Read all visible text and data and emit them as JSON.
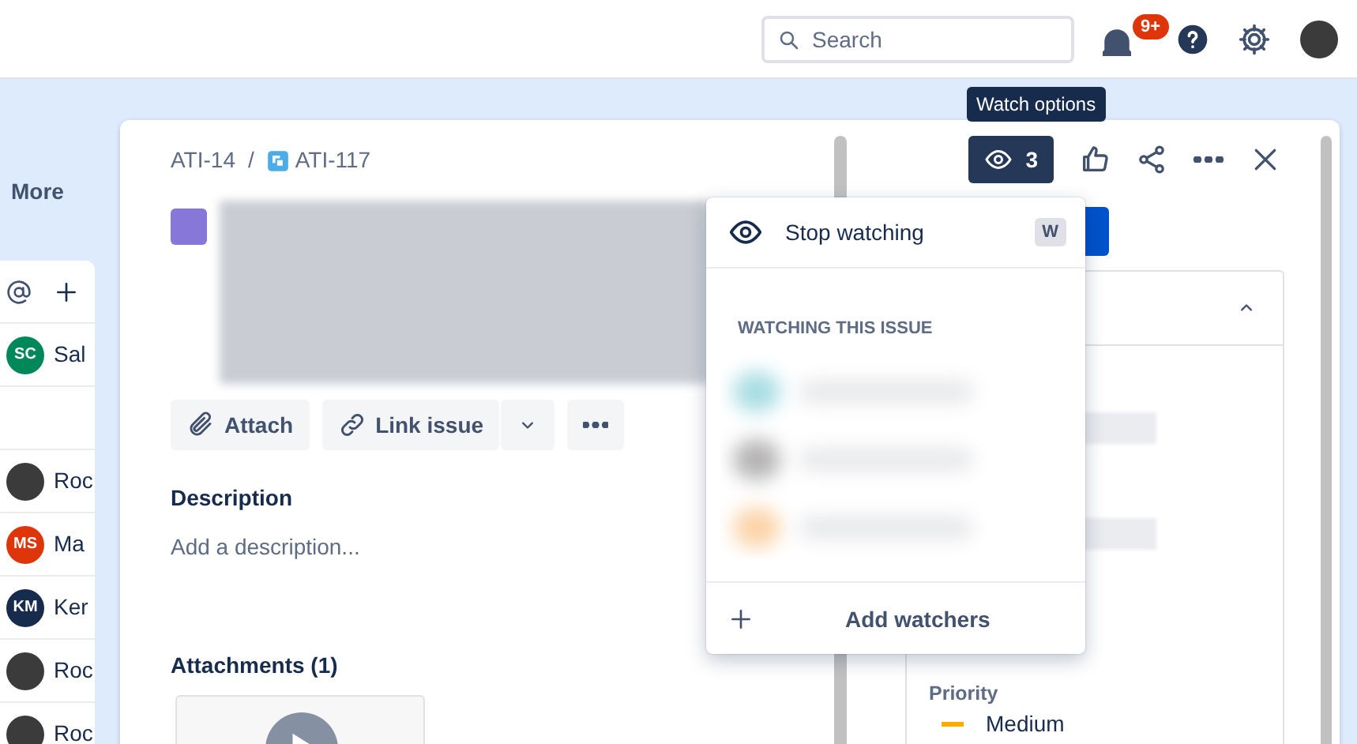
{
  "top_bar": {
    "search": {
      "placeholder": "Search"
    },
    "notifications_badge": "9+"
  },
  "sidebar": {
    "more": "More",
    "people": [
      {
        "kind": "initials",
        "initials": "SC",
        "name": "Sal",
        "color": "#00875a"
      },
      {
        "kind": "blank"
      },
      {
        "kind": "photo",
        "name": "Roc"
      },
      {
        "kind": "initials",
        "initials": "MS",
        "name": "Ma",
        "color": "#de350b"
      },
      {
        "kind": "initials",
        "initials": "KM",
        "name": "Ker",
        "color": "#172b4d"
      },
      {
        "kind": "photo",
        "name": "Roc"
      },
      {
        "kind": "photo",
        "name": "Roc"
      }
    ]
  },
  "issue": {
    "breadcrumb": {
      "parent": "ATI-14",
      "separator": "/",
      "key": "ATI-117"
    },
    "actions": [
      {
        "kind": "attach",
        "label": "Attach"
      },
      {
        "kind": "link",
        "label": "Link issue"
      }
    ],
    "description": {
      "heading": "Description",
      "placeholder": "Add a description..."
    },
    "attachments": {
      "heading": "Attachments (1)"
    }
  },
  "header": {
    "watch_count": "3",
    "tooltip": "Watch options"
  },
  "watch_menu": {
    "items": [
      {
        "label": "Stop watching",
        "shortcut": "W"
      }
    ],
    "section_title": "WATCHING THIS ISSUE",
    "add": "Add watchers"
  },
  "details": {
    "field_label": "Priority",
    "priority": "Medium"
  }
}
